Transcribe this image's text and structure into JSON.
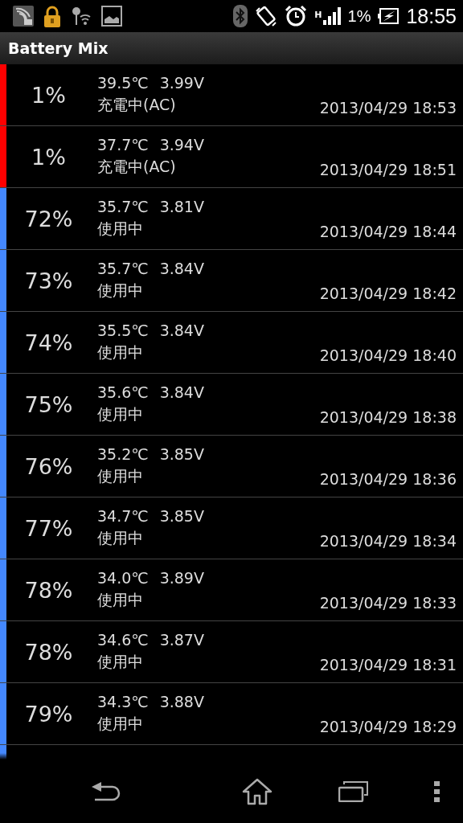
{
  "status_bar": {
    "network_type": "H",
    "battery_percent": "1%",
    "time": "18:55"
  },
  "app_bar": {
    "title": "Battery Mix"
  },
  "rows": [
    {
      "percent": "1%",
      "temperature": "39.5℃",
      "voltage": "3.99V",
      "state": "充電中(AC)",
      "timestamp": "2013/04/29 18:53",
      "color": "#ff0000"
    },
    {
      "percent": "1%",
      "temperature": "37.7℃",
      "voltage": "3.94V",
      "state": "充電中(AC)",
      "timestamp": "2013/04/29 18:51",
      "color": "#ff0000"
    },
    {
      "percent": "72%",
      "temperature": "35.7℃",
      "voltage": "3.81V",
      "state": "使用中",
      "timestamp": "2013/04/29 18:44",
      "color": "#4488ff"
    },
    {
      "percent": "73%",
      "temperature": "35.7℃",
      "voltage": "3.84V",
      "state": "使用中",
      "timestamp": "2013/04/29 18:42",
      "color": "#4488ff"
    },
    {
      "percent": "74%",
      "temperature": "35.5℃",
      "voltage": "3.84V",
      "state": "使用中",
      "timestamp": "2013/04/29 18:40",
      "color": "#4488ff"
    },
    {
      "percent": "75%",
      "temperature": "35.6℃",
      "voltage": "3.84V",
      "state": "使用中",
      "timestamp": "2013/04/29 18:38",
      "color": "#4488ff"
    },
    {
      "percent": "76%",
      "temperature": "35.2℃",
      "voltage": "3.85V",
      "state": "使用中",
      "timestamp": "2013/04/29 18:36",
      "color": "#4488ff"
    },
    {
      "percent": "77%",
      "temperature": "34.7℃",
      "voltage": "3.85V",
      "state": "使用中",
      "timestamp": "2013/04/29 18:34",
      "color": "#4488ff"
    },
    {
      "percent": "78%",
      "temperature": "34.0℃",
      "voltage": "3.89V",
      "state": "使用中",
      "timestamp": "2013/04/29 18:33",
      "color": "#4488ff"
    },
    {
      "percent": "78%",
      "temperature": "34.6℃",
      "voltage": "3.87V",
      "state": "使用中",
      "timestamp": "2013/04/29 18:31",
      "color": "#4488ff"
    },
    {
      "percent": "79%",
      "temperature": "34.3℃",
      "voltage": "3.88V",
      "state": "使用中",
      "timestamp": "2013/04/29 18:29",
      "color": "#4488ff"
    }
  ],
  "partial_row": {
    "color": "#4488ff"
  }
}
